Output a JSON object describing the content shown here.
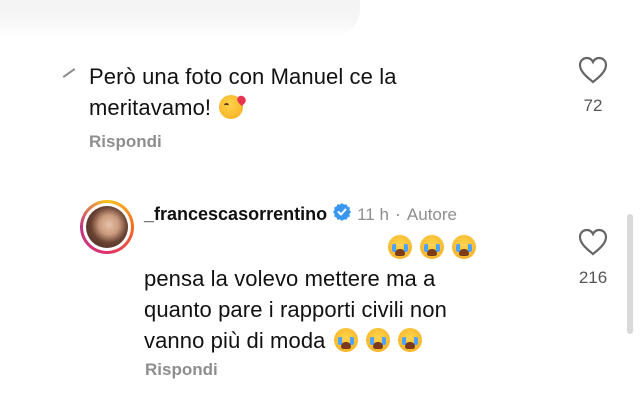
{
  "comment1": {
    "text": "Però una foto con Manuel ce la meritavamo!",
    "line1": "Però una foto con Manuel ce la",
    "line2": "meritavamo!",
    "emoji": "kissing-heart-emoji",
    "reply_label": "Rispondi",
    "likes": "72"
  },
  "comment2": {
    "username": "_francescasorrentino",
    "time": "11 h",
    "separator": "·",
    "author_badge": "Autore",
    "line1": "pensa la volevo mettere ma a",
    "line2": "quanto pare i rapporti civili non",
    "line3": "vanno più di moda",
    "emoji": "loudly-crying-emoji",
    "reply_label": "Rispondi",
    "likes": "216"
  },
  "colors": {
    "verified": "#3897f0",
    "muted": "#8e8e8e",
    "text": "#111111"
  }
}
